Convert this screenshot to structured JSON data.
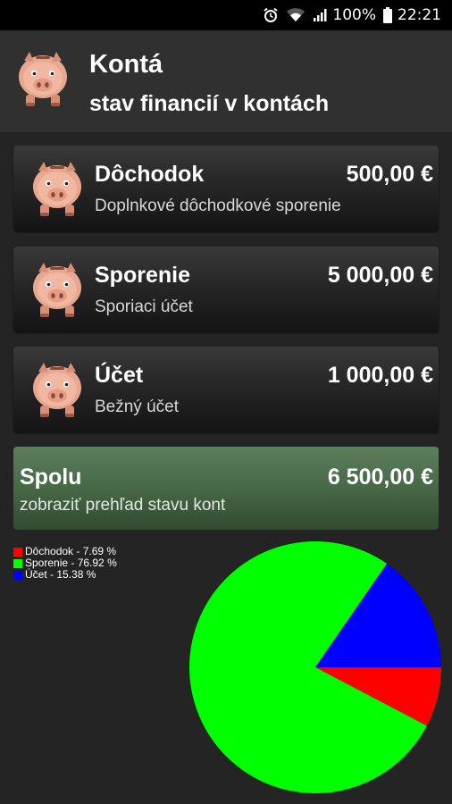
{
  "status_bar": {
    "battery": "100%",
    "time": "22:21",
    "icons": [
      "alarm-icon",
      "wifi-icon",
      "signal-icon",
      "battery-icon"
    ]
  },
  "header": {
    "title": "Kontá",
    "subtitle": "stav financií v kontách",
    "icon": "piggy-bank-icon"
  },
  "accounts": [
    {
      "name": "Dôchodok",
      "amount": "500,00 €",
      "description": "Doplnkové dôchodkové sporenie",
      "icon": "piggy-bank-icon"
    },
    {
      "name": "Sporenie",
      "amount": "5 000,00 €",
      "description": "Sporiaci účet",
      "icon": "piggy-bank-icon"
    },
    {
      "name": "Účet",
      "amount": "1 000,00 €",
      "description": "Bežný účet",
      "icon": "piggy-bank-icon"
    }
  ],
  "total": {
    "name": "Spolu",
    "amount": "6 500,00 €",
    "description": "zobraziť prehľad stavu kont"
  },
  "colors": {
    "background": "#242424",
    "header": "#303030",
    "total_card": "#4a6b49",
    "dochodok": "#ff0000",
    "sporenie": "#00ff00",
    "ucet": "#0000ff"
  },
  "chart_data": {
    "type": "pie",
    "legend_position": "top-left",
    "slices": [
      {
        "label": "Dôchodok - 7.69 %",
        "value": 7.69,
        "color": "#ff0000"
      },
      {
        "label": "Sporenie - 76.92 %",
        "value": 76.92,
        "color": "#00ff00"
      },
      {
        "label": "Účet - 15.38 %",
        "value": 15.38,
        "color": "#0000ff"
      }
    ]
  }
}
